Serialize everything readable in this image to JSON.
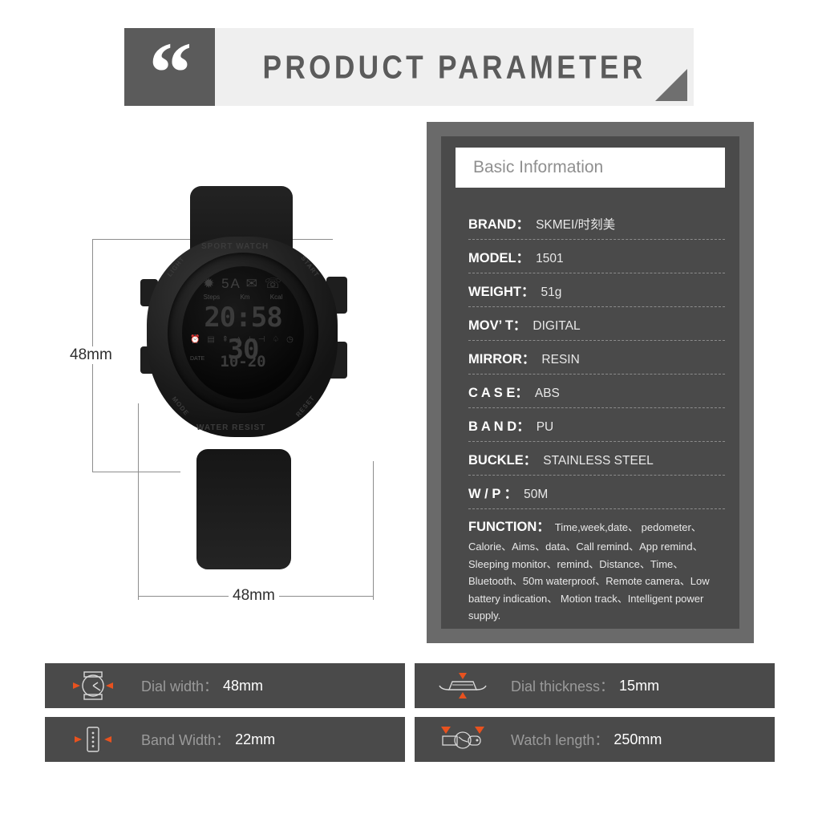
{
  "header": {
    "quote_icon": "quote-mark-icon",
    "title": "PRODUCT PARAMETER"
  },
  "product": {
    "dim_height_label": "48mm",
    "dim_width_label": "48mm",
    "watch": {
      "brand_text_top": "SPORT WATCH",
      "brand_text_bottom": "WATER RESIST",
      "button_light": "LIGHT",
      "button_start": "START",
      "button_mode": "MODE",
      "button_reset": "RESET",
      "lcd_top_icons": "✹ 5A ✉ ☏",
      "lcd_unit_steps": "Steps",
      "lcd_unit_km": "Km",
      "lcd_unit_kcal": "Kcal",
      "lcd_time": "20:58 30",
      "lcd_icon_row": "⏰ ▤ ⇞ ◮ ⊢⊣ ♤ ◷",
      "lcd_date_label": "DATE",
      "lcd_date": "10-20"
    }
  },
  "spec_panel": {
    "title": "Basic Information",
    "rows": [
      {
        "key": "BRAND：",
        "value": "SKMEI/时刻美"
      },
      {
        "key": "MODEL：",
        "value": "1501"
      },
      {
        "key": "WEIGHT：",
        "value": "51g"
      },
      {
        "key": "MOV’ T：",
        "value": "DIGITAL"
      },
      {
        "key": "MIRROR：",
        "value": "RESIN"
      },
      {
        "key": "C A S E：",
        "value": "ABS"
      },
      {
        "key": "B A N D：",
        "value": "PU"
      },
      {
        "key": "BUCKLE：",
        "value": "STAINLESS STEEL"
      },
      {
        "key": "W / P ：",
        "value": "50M"
      }
    ],
    "function": {
      "key": "FUNCTION：",
      "text": "Time,week,date、 pedometer、Calorie、Aims、data、Call remind、App remind、Sleeping monitor、remind、Distance、Time、Bluetooth、50m waterproof、Remote camera、Low battery indication、 Motion track、Intelligent power supply."
    }
  },
  "bottom_bars": [
    {
      "icon": "watch-face-icon",
      "label": "Dial width：",
      "value": "48mm"
    },
    {
      "icon": "watch-profile-icon",
      "label": "Dial thickness：",
      "value": "15mm"
    },
    {
      "icon": "watch-band-icon",
      "label": "Band Width：",
      "value": "22mm"
    },
    {
      "icon": "watch-length-icon",
      "label": "Watch length：",
      "value": "250mm"
    }
  ],
  "colors": {
    "panel_outer": "#6a6a6a",
    "panel_inner": "#4a4a4a",
    "header_strip": "#efefef",
    "accent_orange": "#e8521f",
    "text_gray": "#5b5b5b"
  }
}
